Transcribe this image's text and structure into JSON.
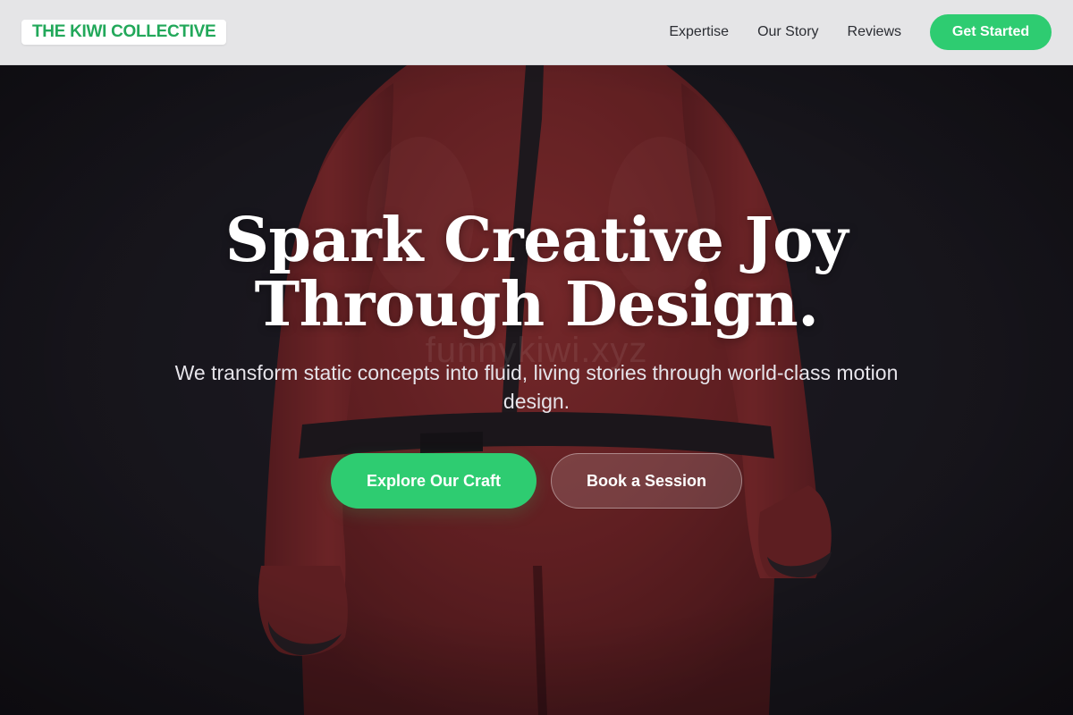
{
  "header": {
    "logo_text": "THE KIWI COLLECTIVE",
    "nav": [
      {
        "label": "Expertise"
      },
      {
        "label": "Our Story"
      },
      {
        "label": "Reviews"
      }
    ],
    "cta_label": "Get Started"
  },
  "hero": {
    "title_line1": "Spark Creative Joy",
    "title_line2": "Through Design.",
    "subtitle": "We transform static concepts into fluid, living stories through world-class motion design.",
    "watermark": "funnykiwi.xyz",
    "primary_button": "Explore Our Craft",
    "secondary_button": "Book a Session"
  },
  "colors": {
    "accent": "#2ecc71",
    "logo_text": "#22a85a",
    "header_bg": "#ececee",
    "hero_bg": "#19181e",
    "figure_suit": "#8b2a2a"
  }
}
